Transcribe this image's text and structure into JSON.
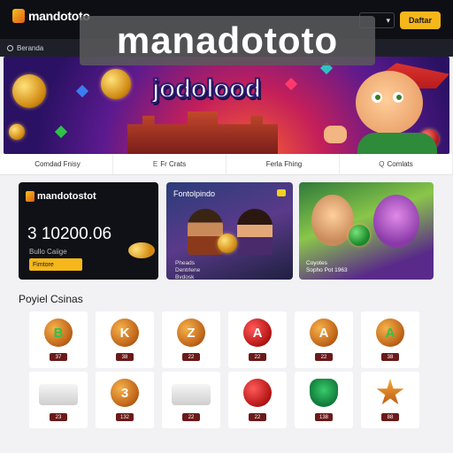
{
  "nav": {
    "brand": "mandototo",
    "lang_label": "",
    "cta_label": "Daftar"
  },
  "subbar": {
    "label": "Beranda"
  },
  "watermark": {
    "text": "manadototo"
  },
  "hero": {
    "title": "jodolood"
  },
  "tabs": [
    {
      "icon": "",
      "label": "Comdad Fnisy"
    },
    {
      "icon": "E",
      "label": "Fr Crats"
    },
    {
      "icon": "",
      "label": "Ferla Fhing"
    },
    {
      "icon": "Q",
      "label": "Comlats"
    }
  ],
  "promos": [
    {
      "brand": "mandotostot",
      "amount": "3 10200.06",
      "sub": "Bullo Caiige",
      "button": "Fimtore"
    },
    {
      "title": "Fontolpindo",
      "text": "Pheads\nDentrlene\nBvdosk"
    },
    {
      "text": "Coyotes\nSopho Pot 1963"
    }
  ],
  "section": {
    "title": "Poyiel Csinas"
  },
  "tiles": [
    {
      "glyph": "B",
      "variant": "green",
      "badge": "37"
    },
    {
      "glyph": "K",
      "variant": "",
      "badge": "38"
    },
    {
      "glyph": "Z",
      "variant": "",
      "badge": "22"
    },
    {
      "glyph": "A",
      "variant": "red",
      "badge": "22"
    },
    {
      "glyph": "A",
      "variant": "",
      "badge": "22"
    },
    {
      "glyph": "A",
      "variant": "green",
      "badge": "38"
    },
    {
      "glyph": "",
      "variant": "shoe",
      "badge": "23"
    },
    {
      "glyph": "3",
      "variant": "",
      "badge": "132"
    },
    {
      "glyph": "",
      "variant": "shoe",
      "badge": "22"
    },
    {
      "glyph": "",
      "variant": "red",
      "badge": "22"
    },
    {
      "glyph": "",
      "variant": "tree",
      "badge": "138"
    },
    {
      "glyph": "",
      "variant": "star",
      "badge": "88"
    }
  ],
  "colors": {
    "accent": "#f5b71a",
    "nav_bg": "#0d0f14",
    "badge": "#6b1a1a"
  }
}
